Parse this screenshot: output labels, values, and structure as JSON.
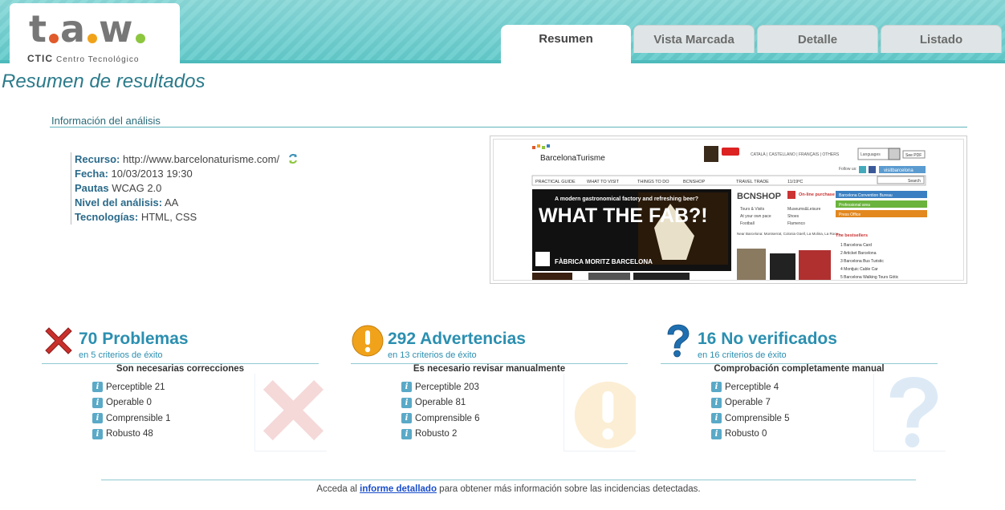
{
  "logo": {
    "letters": [
      "t",
      "a",
      "w"
    ],
    "dot_colors": [
      "#e05a2b",
      "#f0a31a",
      "#8dc63f"
    ],
    "brand": "CTIC",
    "tagline": "Centro Tecnológico"
  },
  "tabs": [
    {
      "label": "Resumen",
      "active": true
    },
    {
      "label": "Vista Marcada",
      "active": false
    },
    {
      "label": "Detalle",
      "active": false
    },
    {
      "label": "Listado",
      "active": false
    }
  ],
  "page_title": "Resumen de resultados",
  "analysis": {
    "section_title": "Información del análisis",
    "resource_label": "Recurso:",
    "resource_value": "http://www.barcelonaturisme.com/",
    "date_label": "Fecha:",
    "date_value": "10/03/2013 19:30",
    "guidelines_label": "Pautas",
    "guidelines_value": "WCAG 2.0",
    "level_label": "Nivel del análisis:",
    "level_value": "AA",
    "tech_label": "Tecnologías:",
    "tech_value": "HTML, CSS"
  },
  "thumbnail": {
    "site_name": "BarcelonaTurisme",
    "nav": [
      "PRACTICAL GUIDE",
      "WHAT TO VISIT",
      "THINGS TO DO",
      "BCNSHOP",
      "TRAVEL TRADE",
      "11/19ºC"
    ],
    "lang": [
      "CATALÀ",
      "CASTELLANO",
      "FRANÇAIS",
      "OTHERS"
    ],
    "hero_line": "A modern gastronomical factory and refreshing beer?",
    "hero_big": "WHAT THE FAB?!",
    "hero_brand": "FÀBRICA MORITZ BARCELONA",
    "shop_title": "BCNSHOP",
    "online": "On-line purchase",
    "side_links": [
      "Barcelona Convention Bureau",
      "Professional area",
      "Press Office"
    ],
    "side_colors": [
      "#3a7fc1",
      "#6ab33c",
      "#e2881f"
    ],
    "bestsellers_title": "The bestsellers",
    "bestsellers": [
      "Barcelona Card",
      "Articket Barcelona",
      "Barcelona Bus Turistic",
      "Montjuic Cable Car",
      "Barcelona Walking Tours Gòtic"
    ],
    "shop_items": [
      "Tours & Visits",
      "Museums&Leisure",
      "At your own pace",
      "Shoes",
      "Football",
      "Flamenco"
    ],
    "near": "Near Barcelona: Montserrat, Colonia Güell, La Molina, La Roca…",
    "follow": "Follow us:",
    "visit": "visitbarcelona",
    "see_pdf": "See PDF",
    "languages": "Languages",
    "search": "Search"
  },
  "summary": [
    {
      "kind": "problems",
      "count_label": "70 Problemas",
      "sub_label": "en 5 criterios de éxito",
      "caption": "Son necesarias correcciones",
      "color": "#c9302c",
      "rows": [
        "Perceptible 21",
        "Operable 0",
        "Comprensible 1",
        "Robusto 48"
      ]
    },
    {
      "kind": "warnings",
      "count_label": "292 Advertencias",
      "sub_label": "en 13 criterios de éxito",
      "caption": "Es necesario revisar manualmente",
      "color": "#f0a31a",
      "rows": [
        "Perceptible 203",
        "Operable 81",
        "Comprensible 6",
        "Robusto 2"
      ]
    },
    {
      "kind": "unverified",
      "count_label": "16 No verificados",
      "sub_label": "en 16 criterios de éxito",
      "caption": "Comprobación completamente manual",
      "color": "#1f6fb0",
      "rows": [
        "Perceptible 4",
        "Operable 7",
        "Comprensible 5",
        "Robusto 0"
      ]
    }
  ],
  "footer": {
    "before": "Acceda al ",
    "link": "informe detallado",
    "after": " para obtener más información sobre las incidencias detectadas."
  }
}
